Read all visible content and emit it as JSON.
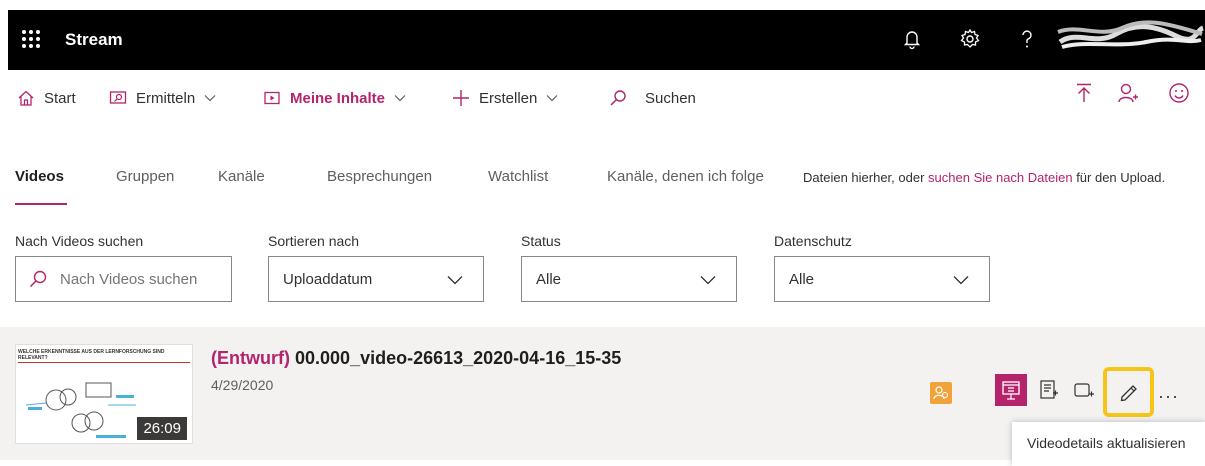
{
  "header": {
    "app_title": "Stream",
    "icons": [
      "waffle-icon",
      "bell-icon",
      "gear-icon",
      "help-icon"
    ]
  },
  "nav": {
    "start": "Start",
    "discover": "Ermitteln",
    "my_content": "Meine Inhalte",
    "create": "Erstellen",
    "search": "Suchen"
  },
  "tabs": [
    {
      "label": "Videos",
      "active": true
    },
    {
      "label": "Gruppen"
    },
    {
      "label": "Kanäle"
    },
    {
      "label": "Besprechungen"
    },
    {
      "label": "Watchlist"
    },
    {
      "label": "Kanäle, denen ich folge"
    }
  ],
  "upload_hint": {
    "before": "Dateien hierher, oder ",
    "link": "suchen Sie nach Dateien",
    "after": " für den Upload."
  },
  "filters": {
    "search_label": "Nach Videos suchen",
    "search_placeholder": "Nach Videos suchen",
    "sort_label": "Sortieren nach",
    "sort_value": "Uploaddatum",
    "status_label": "Status",
    "status_value": "Alle",
    "privacy_label": "Datenschutz",
    "privacy_value": "Alle"
  },
  "video": {
    "draft_tag": "(Entwurf)",
    "title": "00.000_video-26613_2020-04-16_15-35",
    "date": "4/29/2020",
    "duration": "26:09",
    "thumb_title": "WELCHE ERKENNTNISSE AUS DER LERNFORSCHUNG SIND RELEVANT?",
    "more": "···"
  },
  "tooltip": "Videodetails aktualisieren",
  "colors": {
    "accent": "#b4236c",
    "highlight": "#f5c518",
    "header_bg": "#000000",
    "badge": "#f2a23b"
  }
}
